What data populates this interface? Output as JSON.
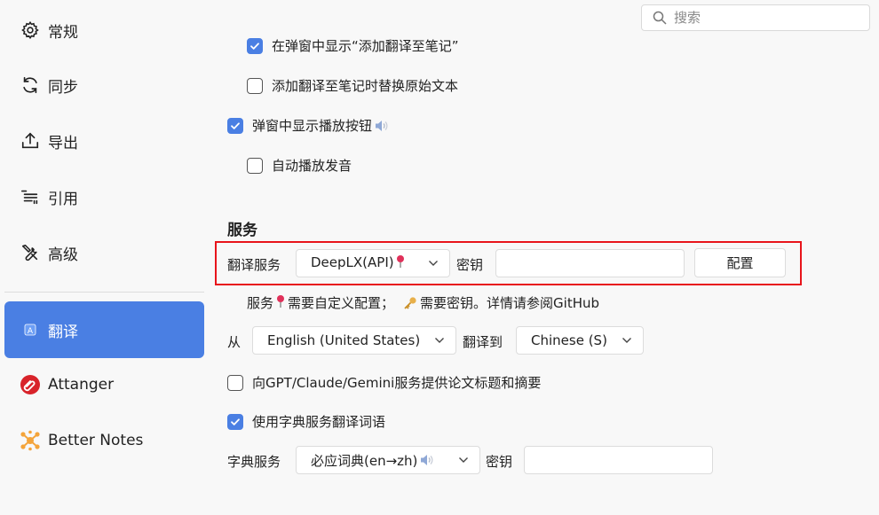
{
  "search": {
    "placeholder": "搜索"
  },
  "sidebar": {
    "items": [
      {
        "label": "常规",
        "icon": "gear-icon"
      },
      {
        "label": "同步",
        "icon": "sync-icon"
      },
      {
        "label": "导出",
        "icon": "export-icon"
      },
      {
        "label": "引用",
        "icon": "quote-icon"
      },
      {
        "label": "高级",
        "icon": "tools-icon"
      },
      {
        "label": "翻译",
        "icon": "translate-icon",
        "active": true
      },
      {
        "label": "Attanger",
        "icon": "attanger-icon"
      },
      {
        "label": "Better Notes",
        "icon": "better-notes-icon"
      }
    ]
  },
  "options": {
    "show_add_note": {
      "label": "在弹窗中显示“添加翻译至笔记”",
      "checked": true
    },
    "replace_original": {
      "label": "添加翻译至笔记时替换原始文本",
      "checked": false
    },
    "show_play_button": {
      "label": "弹窗中显示播放按钮",
      "checked": true
    },
    "auto_play": {
      "label": "自动播放发音",
      "checked": false
    }
  },
  "service": {
    "title": "服务",
    "label": "翻译服务",
    "selected": "DeepLX(API)",
    "key_label": "密钥",
    "key_value": "",
    "config_button": "配置",
    "note_prefix": "服务",
    "note_custom": "需要自定义配置；",
    "note_key": "需要密钥。详情请参阅GitHub"
  },
  "languages": {
    "from_label": "从",
    "from_value": "English (United States)",
    "to_label": "翻译到",
    "to_value": "Chinese (S)"
  },
  "gpt_option": {
    "label": "向GPT/Claude/Gemini服务提供论文标题和摘要",
    "checked": false
  },
  "dict_option": {
    "label": "使用字典服务翻译词语",
    "checked": true
  },
  "dictionary": {
    "label": "字典服务",
    "selected": "必应词典(en→zh)",
    "key_label": "密钥",
    "key_value": ""
  },
  "colors": {
    "accent": "#4a7fe3",
    "highlight": "#e8141b"
  }
}
